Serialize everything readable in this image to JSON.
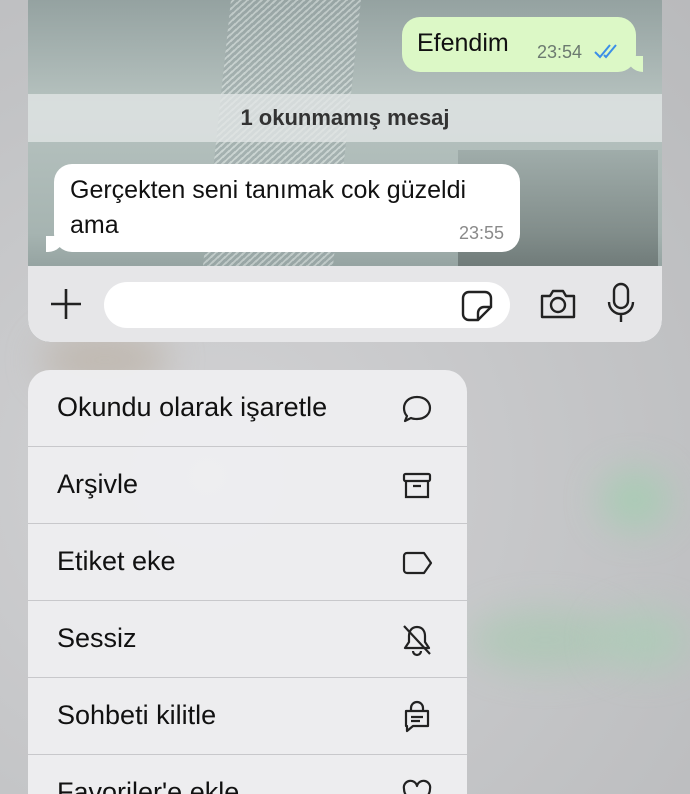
{
  "chat": {
    "outgoing": {
      "text": "Efendim",
      "time": "23:54",
      "status": "read"
    },
    "unread_banner": "1 okunmamış mesaj",
    "incoming": {
      "text": "Gerçekten seni tanımak cok güzeldi ama",
      "time": "23:55"
    }
  },
  "input_bar": {
    "placeholder": "",
    "icons": [
      "plus-icon",
      "sticker-icon",
      "camera-icon",
      "microphone-icon"
    ]
  },
  "context_menu": {
    "items": [
      {
        "label": "Okundu olarak işaretle",
        "icon": "chat-bubble-icon"
      },
      {
        "label": "Arşivle",
        "icon": "archive-icon"
      },
      {
        "label": "Etiket eke",
        "icon": "label-tag-icon"
      },
      {
        "label": "Sessiz",
        "icon": "bell-slash-icon"
      },
      {
        "label": "Sohbeti kilitle",
        "icon": "chat-lock-icon"
      },
      {
        "label": "Favoriler'e ekle",
        "icon": "heart-icon"
      }
    ]
  },
  "colors": {
    "outgoing_bubble": "#dcf8c6",
    "incoming_bubble": "#ffffff",
    "read_ticks": "#3b8ee8",
    "menu_bg": "#eeeef0"
  }
}
